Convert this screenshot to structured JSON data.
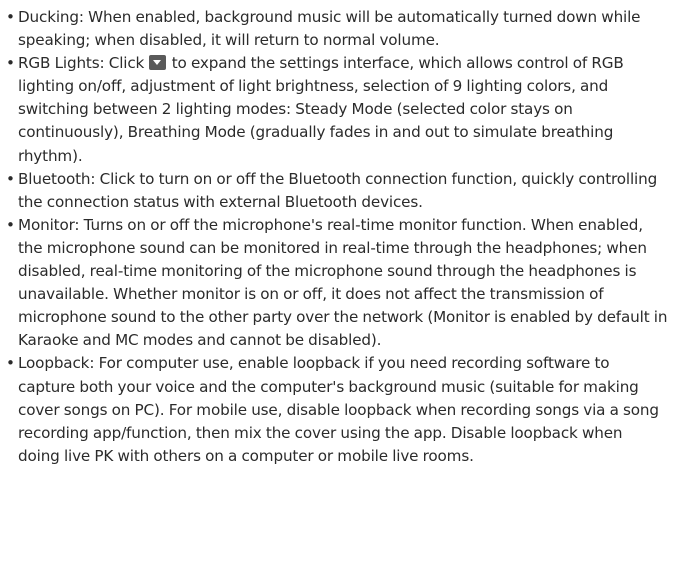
{
  "bullet": "•",
  "items": [
    {
      "term": "Ducking",
      "text": "When enabled, background music will be automatically turned down while speaking; when disabled, it will return to normal volume."
    },
    {
      "term": "RGB Lights",
      "text_before_icon": "Click",
      "icon": "chevron-down-icon",
      "text_after_icon": "to expand the settings interface, which allows control of RGB lighting on/off, adjustment of light brightness, selection of 9 lighting colors, and switching between 2 lighting modes: Steady Mode (selected color stays on continuously), Breathing Mode (gradually fades in and out to simulate breathing rhythm)."
    },
    {
      "term": "Bluetooth",
      "text": "Click to turn on or off the Bluetooth connection function, quickly controlling the connection status with external Bluetooth devices."
    },
    {
      "term": "Monitor",
      "text": "Turns on or off the microphone's real-time monitor function. When enabled, the microphone sound can be monitored in real-time through the headphones; when disabled, real-time monitoring of the microphone sound through the headphones is unavailable. Whether monitor is on or off, it does not affect the transmission of microphone sound to the other party over the network (Monitor is enabled by default in Karaoke and MC modes and cannot be disabled)."
    },
    {
      "term": "Loopback",
      "text": "For computer use, enable loopback if you need recording software to capture both your voice and the computer's background music (suitable for making cover songs on PC). For mobile use, disable loopback when recording songs via a song recording app/function, then mix the cover using the app. Disable loopback when doing live PK with others on a computer or mobile live rooms."
    }
  ]
}
